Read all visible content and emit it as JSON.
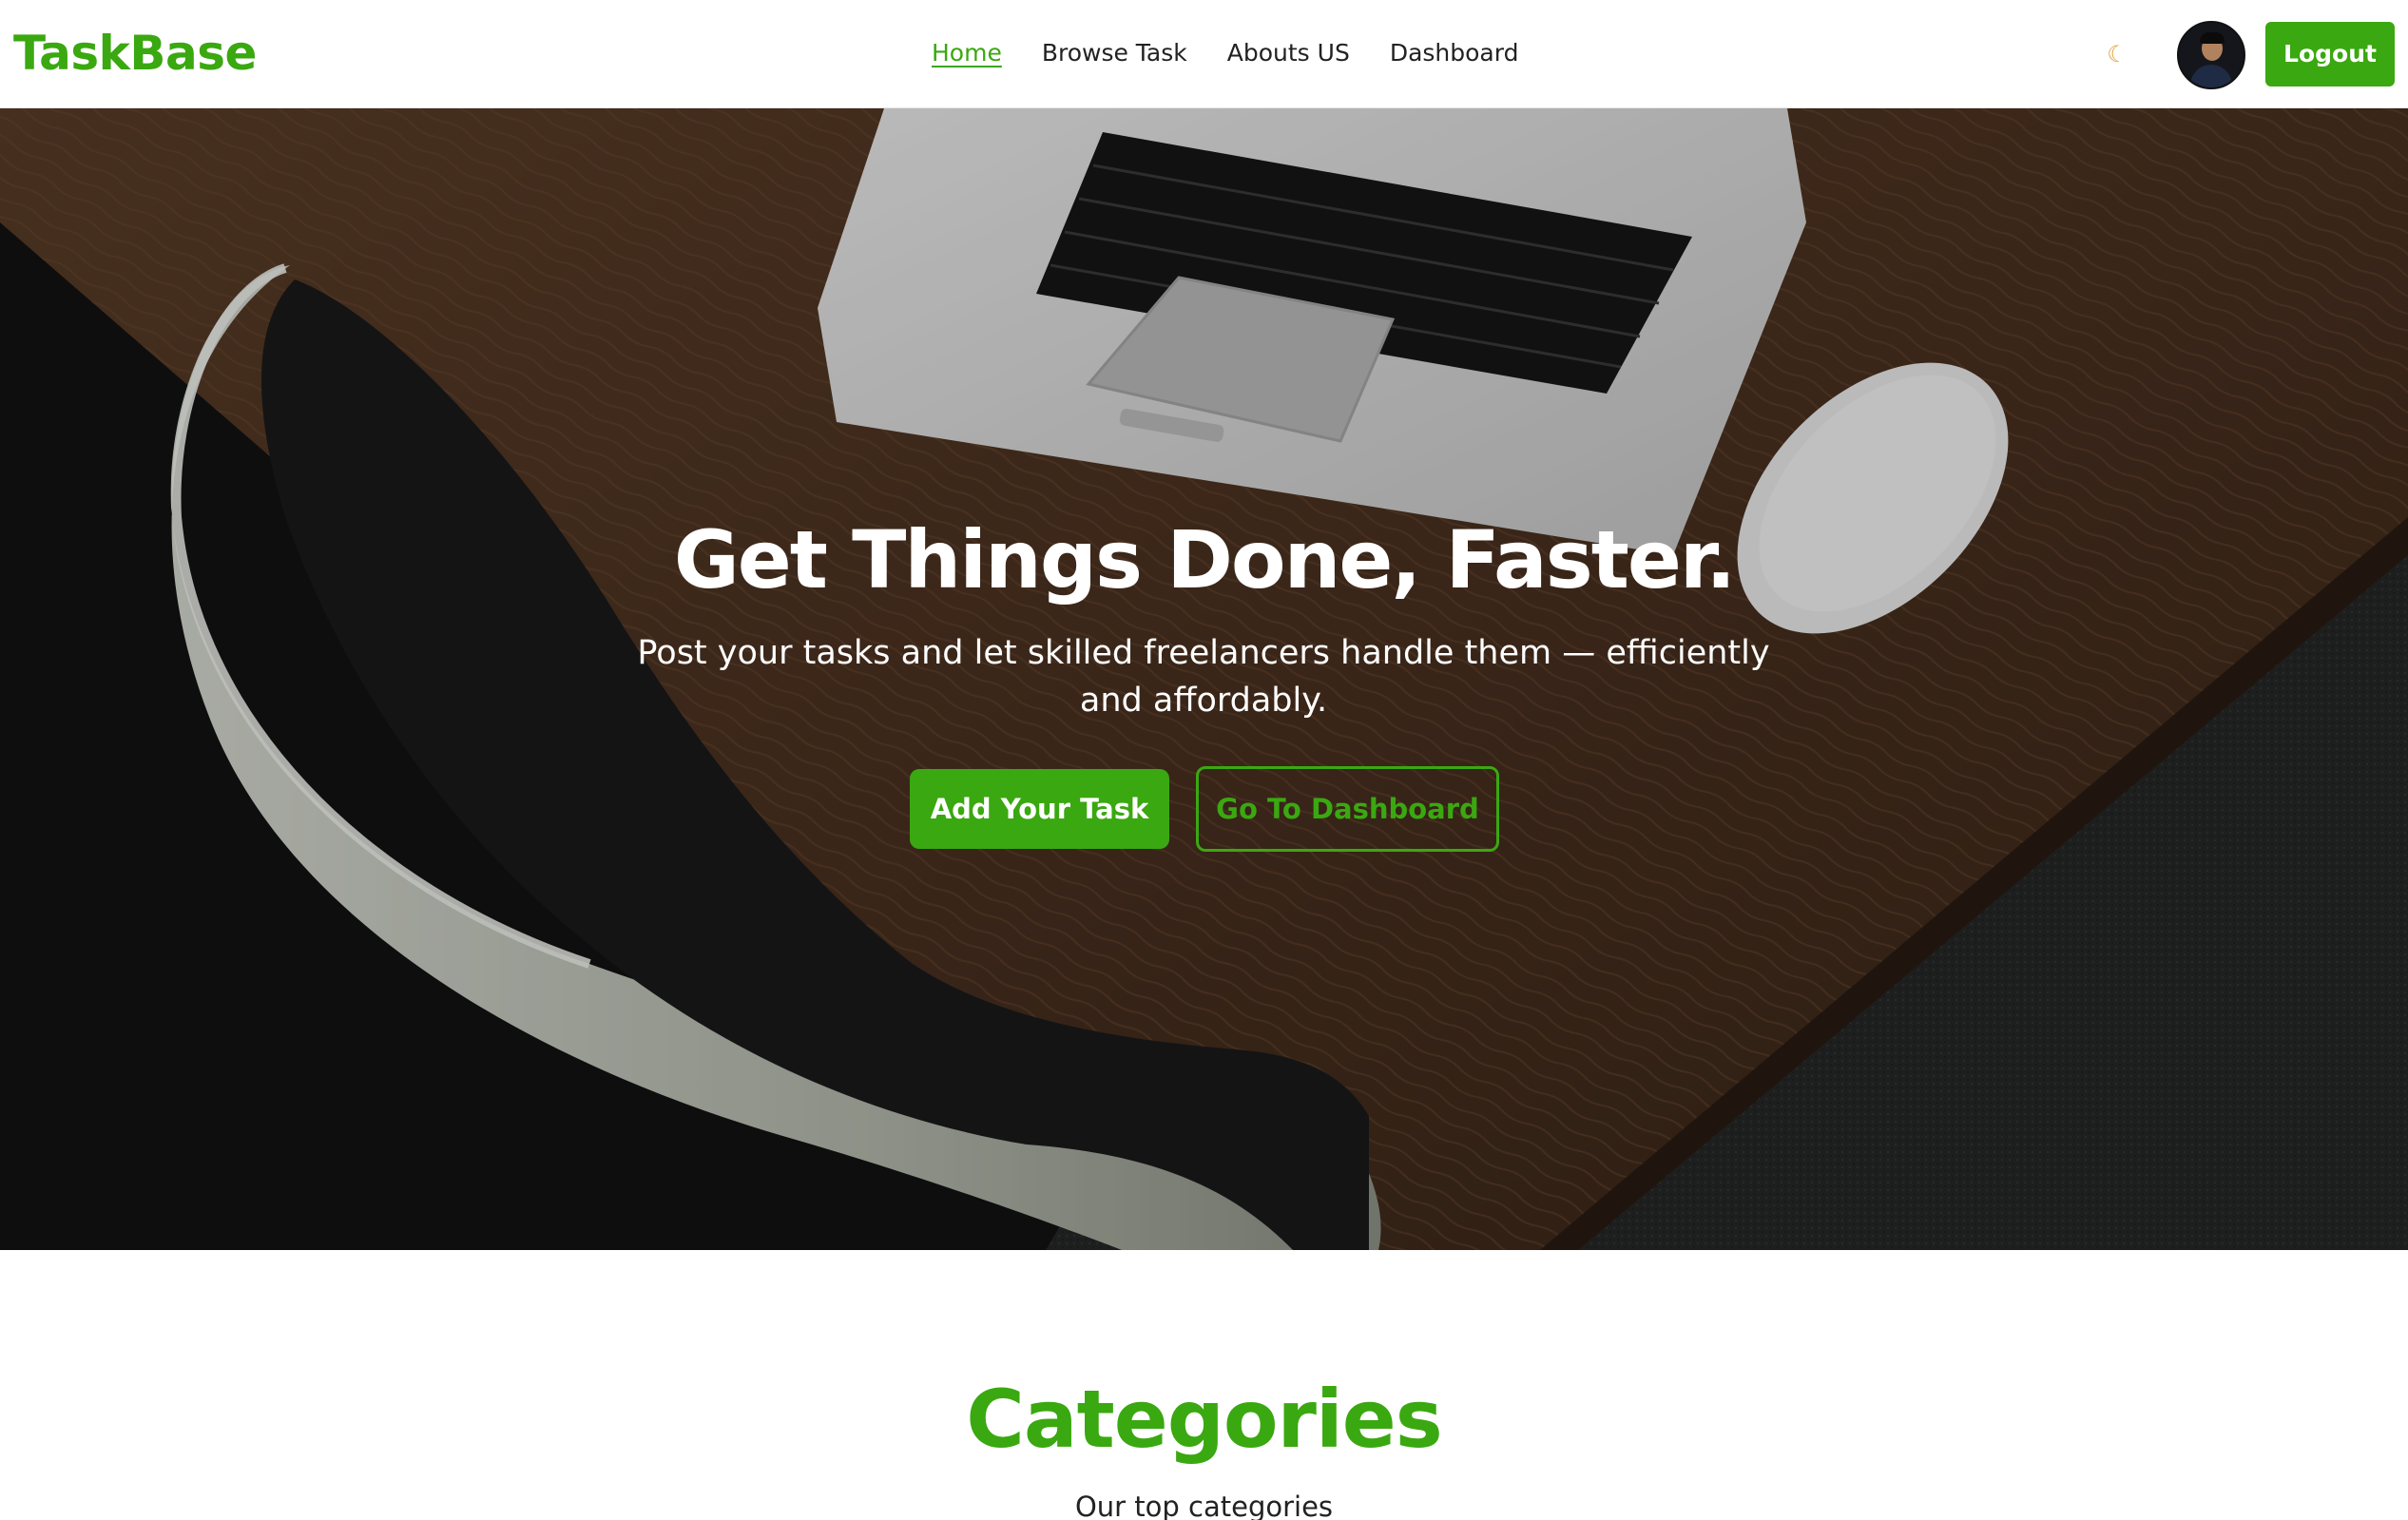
{
  "brand": {
    "name": "TaskBase"
  },
  "nav": {
    "items": [
      {
        "label": "Home",
        "active": true
      },
      {
        "label": "Browse Task",
        "active": false
      },
      {
        "label": "Abouts US",
        "active": false
      },
      {
        "label": "Dashboard",
        "active": false
      }
    ],
    "theme_toggle_icon": "moon-icon",
    "logout_label": "Logout"
  },
  "hero": {
    "title": "Get Things Done, Faster.",
    "subtitle": "Post your tasks and let skilled freelancers handle them — efficiently and affordably.",
    "primary_button": "Add Your Task",
    "secondary_button": "Go To Dashboard"
  },
  "categories": {
    "title": "Categories",
    "subtitle": "Our top categories"
  },
  "colors": {
    "accent": "#3aa810",
    "text": "#222222",
    "background": "#ffffff"
  }
}
